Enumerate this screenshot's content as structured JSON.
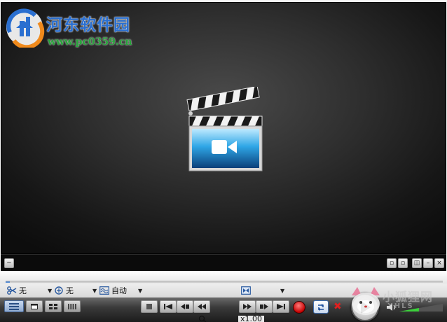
{
  "watermark": {
    "title": "河东软件园",
    "url": "www.pc0359.cn"
  },
  "options": {
    "subtitle_value": "无",
    "aspect_value": "无",
    "audio_value": "自动"
  },
  "playback": {
    "speed": "x1.00",
    "progress": 0.01,
    "volume": 0.45
  },
  "mascot": {
    "text": "小狐狸网",
    "sub": "XHLS"
  },
  "colors": {
    "watermark_title": "#2a6fd0",
    "watermark_url": "#27a33a",
    "record": "#c40000",
    "close": "#e02020",
    "volume": "#3cd03c"
  },
  "icons": {
    "clapperboard": "clapperboard-video-icon",
    "play": "play-icon",
    "record": "record-icon",
    "loop": "loop-icon",
    "volume": "speaker-icon"
  }
}
